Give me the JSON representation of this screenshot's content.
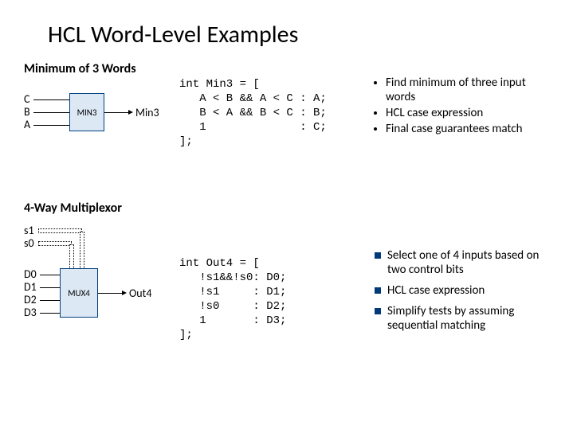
{
  "title": "HCL Word-Level Examples",
  "section1": {
    "subtitle": "Minimum of 3 Words",
    "inputs": [
      "C",
      "B",
      "A"
    ],
    "box": "MIN3",
    "out": "Min3",
    "code": "int Min3 = [\n   A < B && A < C : A;\n   B < A && B < C : B;\n   1              : C;\n];",
    "bullets": [
      "Find minimum of three input words",
      "HCL case expression",
      "Final case guarantees match"
    ]
  },
  "section2": {
    "subtitle": "4-Way Multiplexor",
    "selects": [
      "s1",
      "s0"
    ],
    "inputs": [
      "D0",
      "D1",
      "D2",
      "D3"
    ],
    "box": "MUX4",
    "out": "Out4",
    "code": "int Out4 = [\n   !s1&&!s0: D0;\n   !s1     : D1;\n   !s0     : D2;\n   1       : D3;\n];",
    "bullets": [
      "Select one of 4 inputs based on two control bits",
      "HCL case expression",
      "Simplify tests by assuming sequential matching"
    ]
  }
}
